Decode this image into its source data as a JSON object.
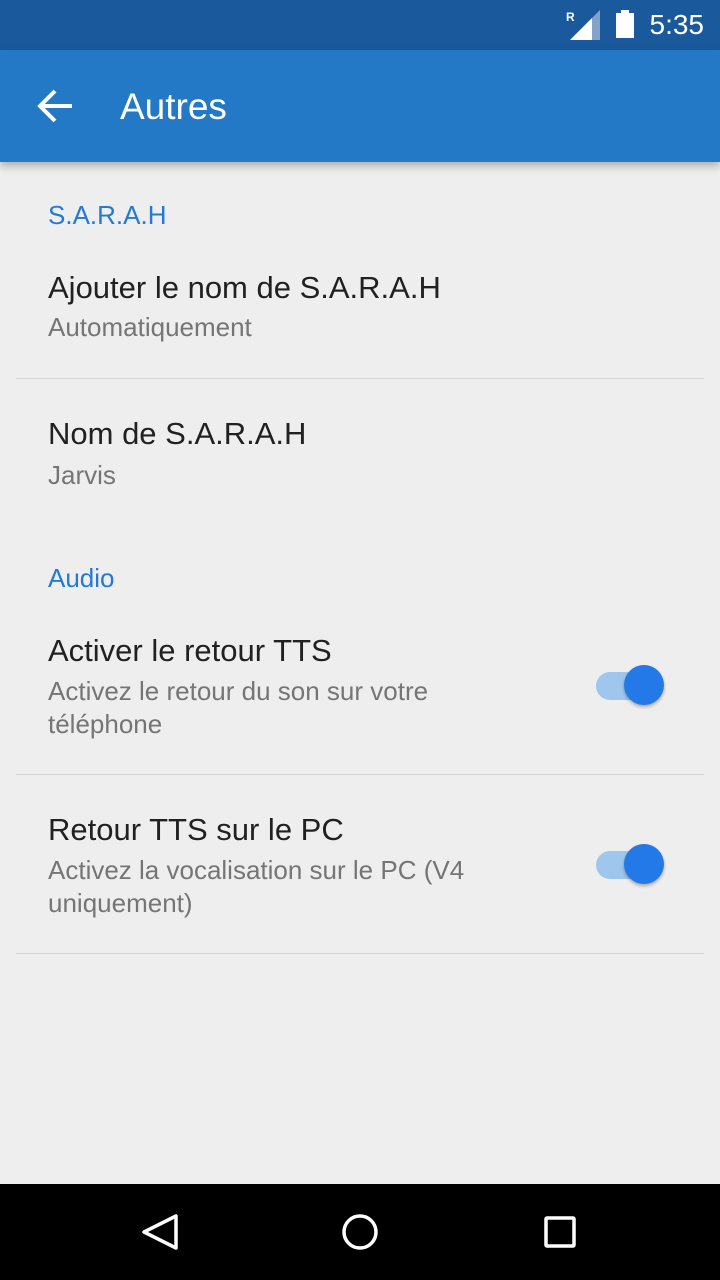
{
  "status_bar": {
    "time": "5:35",
    "roaming_indicator": "R",
    "icons": [
      "signal-icon",
      "battery-icon"
    ]
  },
  "toolbar": {
    "back_icon": "arrow-left-icon",
    "title": "Autres"
  },
  "sections": [
    {
      "header": "S.A.R.A.H",
      "items": [
        {
          "title": "Ajouter le nom de S.A.R.A.H",
          "summary": "Automatiquement"
        },
        {
          "title": "Nom de S.A.R.A.H",
          "summary": "Jarvis"
        }
      ]
    },
    {
      "header": "Audio",
      "items": [
        {
          "title": "Activer le retour TTS",
          "summary_line1": "Activez le retour du son sur votre",
          "summary_line2": "téléphone",
          "switch_on": true
        },
        {
          "title": "Retour TTS sur le PC",
          "summary_line1": "Activez la vocalisation sur le PC (V4",
          "summary_line2": "uniquement)",
          "switch_on": true
        }
      ]
    }
  ],
  "nav_bar": {
    "buttons": [
      "back-triangle-icon",
      "home-circle-icon",
      "recents-square-icon"
    ]
  },
  "colors": {
    "status_bar": "#1a5a9c",
    "toolbar": "#2479c6",
    "accent": "#2479e8",
    "background": "#eeeeee"
  }
}
